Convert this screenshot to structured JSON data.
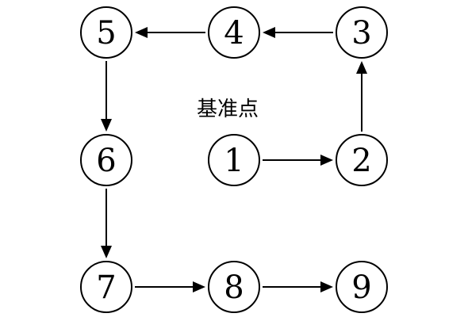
{
  "diagram": {
    "center_label": "基准点",
    "nodes": [
      {
        "id": "1",
        "label": "1"
      },
      {
        "id": "2",
        "label": "2"
      },
      {
        "id": "3",
        "label": "3"
      },
      {
        "id": "4",
        "label": "4"
      },
      {
        "id": "5",
        "label": "5"
      },
      {
        "id": "6",
        "label": "6"
      },
      {
        "id": "7",
        "label": "7"
      },
      {
        "id": "8",
        "label": "8"
      },
      {
        "id": "9",
        "label": "9"
      }
    ],
    "edges": [
      {
        "from": "1",
        "to": "2"
      },
      {
        "from": "2",
        "to": "3"
      },
      {
        "from": "3",
        "to": "4"
      },
      {
        "from": "4",
        "to": "5"
      },
      {
        "from": "5",
        "to": "6"
      },
      {
        "from": "6",
        "to": "7"
      },
      {
        "from": "7",
        "to": "8"
      },
      {
        "from": "8",
        "to": "9"
      }
    ]
  }
}
